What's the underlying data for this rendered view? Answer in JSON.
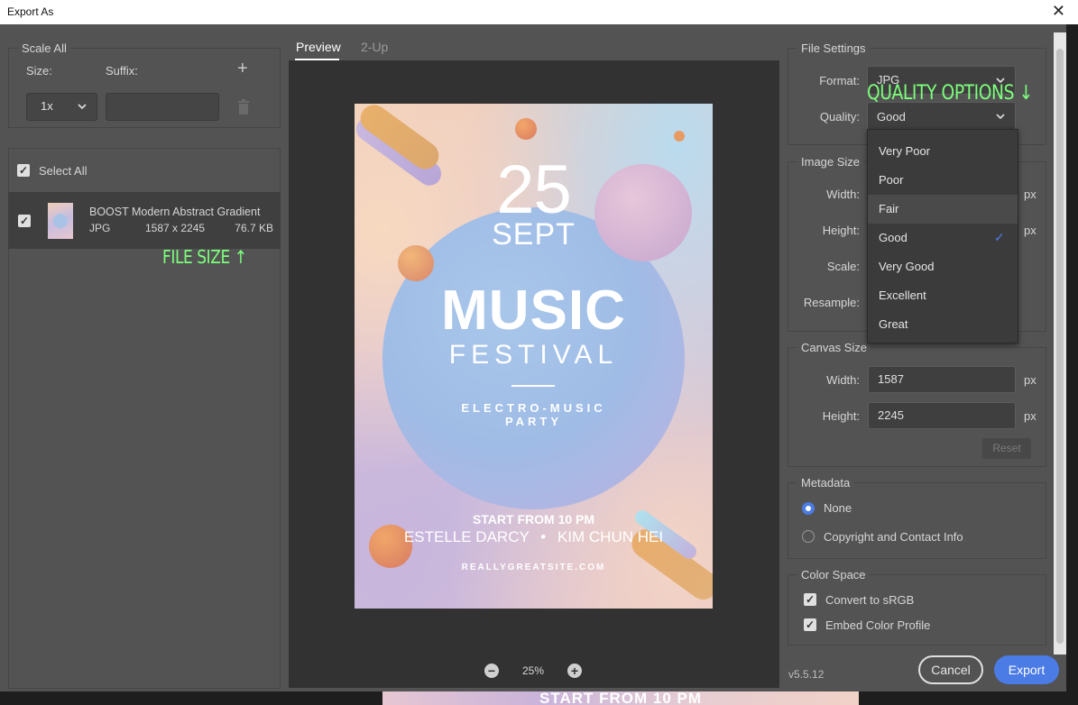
{
  "window": {
    "title": "Export As",
    "close_glyph": "✕"
  },
  "left": {
    "scale_all": {
      "legend": "Scale All",
      "size_label": "Size:",
      "suffix_label": "Suffix:",
      "add_glyph": "+",
      "size_value": "1x",
      "suffix_value": "",
      "delete_icon": "trash-icon"
    },
    "select_all_label": "Select All",
    "file": {
      "name": "BOOST Modern Abstract Gradient",
      "format": "JPG",
      "dimensions": "1587 x 2245",
      "size": "76.7 KB"
    }
  },
  "tabs": [
    {
      "label": "Preview"
    },
    {
      "label": "2-Up"
    }
  ],
  "poster": {
    "day": "25",
    "month": "SEPT",
    "title": "MUSIC",
    "subtitle": "FESTIVAL",
    "tag_line1": "ELECTRO-MUSIC",
    "tag_line2": "PARTY",
    "start": "START FROM 10 PM",
    "artist1": "ESTELLE DARCY",
    "bullet": "•",
    "artist2": "KIM CHUN HEI",
    "site": "REALLYGREATSITE.COM"
  },
  "zoom": {
    "value": "25%",
    "minus": "−",
    "plus": "+"
  },
  "file_settings": {
    "legend": "File Settings",
    "format_label": "Format:",
    "format_value": "JPG",
    "quality_label": "Quality:",
    "quality_value": "Good"
  },
  "quality_options": [
    {
      "label": "Very Poor"
    },
    {
      "label": "Poor"
    },
    {
      "label": "Fair"
    },
    {
      "label": "Good",
      "check": "✓"
    },
    {
      "label": "Very Good"
    },
    {
      "label": "Excellent"
    },
    {
      "label": "Great"
    }
  ],
  "image_size": {
    "legend": "Image Size",
    "width_label": "Width:",
    "height_label": "Height:",
    "scale_label": "Scale:",
    "resample_label": "Resample:",
    "unit": "px"
  },
  "canvas_size": {
    "legend": "Canvas Size",
    "width_label": "Width:",
    "width_value": "1587",
    "height_label": "Height:",
    "height_value": "2245",
    "unit": "px",
    "reset_label": "Reset"
  },
  "metadata": {
    "legend": "Metadata",
    "options": [
      {
        "label": "None"
      },
      {
        "label": "Copyright and Contact Info"
      }
    ]
  },
  "color_space": {
    "legend": "Color Space",
    "convert_label": "Convert to sRGB",
    "embed_label": "Embed Color Profile"
  },
  "footer": {
    "version": "v5.5.12",
    "cancel_label": "Cancel",
    "export_label": "Export"
  },
  "annotations": {
    "quality": "QUALITY OPTIONS",
    "file_size": "FILE SIZE",
    "down_arrow": "↓",
    "up_arrow": "↑"
  },
  "underlay_text": "START FROM 10 PM",
  "colors": {
    "accent": "#4b7be5",
    "annotation": "#7cff7c",
    "panel": "#535353",
    "preview_bg": "#323232"
  }
}
